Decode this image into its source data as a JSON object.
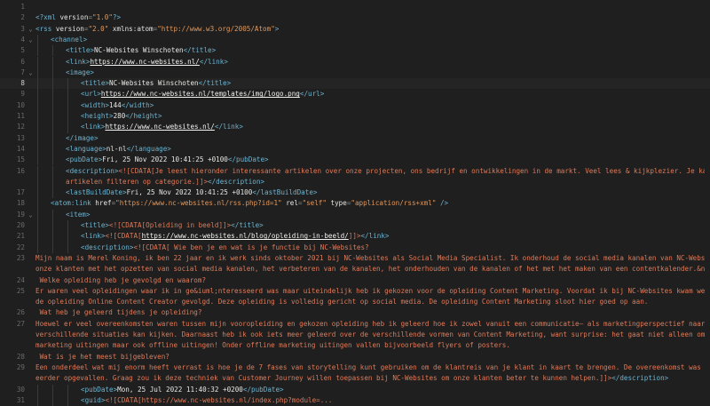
{
  "colors": {
    "background": "#1e1f1e",
    "tag": "#6eb4d2",
    "attribute": "#e5e5e3",
    "string": "#e3985f",
    "cdata": "#e07a5a",
    "text": "#e8e8e6",
    "line_number": "#6a6b69"
  },
  "current_line": 8,
  "lines": [
    {
      "n": "1",
      "fold": "",
      "indent": 0,
      "tokens": []
    },
    {
      "n": "2",
      "fold": "",
      "indent": 0,
      "tokens": [
        {
          "t": "tag",
          "v": "<?xml "
        },
        {
          "t": "attr",
          "v": "version"
        },
        {
          "t": "punct",
          "v": "="
        },
        {
          "t": "str",
          "v": "\"1.0\""
        },
        {
          "t": "tag",
          "v": "?>"
        }
      ]
    },
    {
      "n": "3",
      "fold": "v",
      "indent": 0,
      "tokens": [
        {
          "t": "tag",
          "v": "<rss "
        },
        {
          "t": "attr",
          "v": "version"
        },
        {
          "t": "punct",
          "v": "="
        },
        {
          "t": "str",
          "v": "\"2.0\""
        },
        {
          "t": "text",
          "v": " "
        },
        {
          "t": "attr",
          "v": "xmlns:atom"
        },
        {
          "t": "punct",
          "v": "="
        },
        {
          "t": "str",
          "v": "\"http://www.w3.org/2005/Atom\""
        },
        {
          "t": "tag",
          "v": ">"
        }
      ]
    },
    {
      "n": "4",
      "fold": "v",
      "indent": 1,
      "tokens": [
        {
          "t": "tag",
          "v": "<channel>"
        }
      ]
    },
    {
      "n": "5",
      "fold": "",
      "indent": 2,
      "tokens": [
        {
          "t": "tag",
          "v": "<title>"
        },
        {
          "t": "text",
          "v": "NC-Websites Winschoten"
        },
        {
          "t": "tag",
          "v": "</title>"
        }
      ]
    },
    {
      "n": "6",
      "fold": "",
      "indent": 2,
      "tokens": [
        {
          "t": "tag",
          "v": "<link>"
        },
        {
          "t": "url",
          "v": "https://www.nc-websites.nl/"
        },
        {
          "t": "tag",
          "v": "</link>"
        }
      ]
    },
    {
      "n": "7",
      "fold": "v",
      "indent": 2,
      "tokens": [
        {
          "t": "tag",
          "v": "<image>"
        }
      ]
    },
    {
      "n": "8",
      "fold": "",
      "indent": 3,
      "tokens": [
        {
          "t": "tag",
          "v": "<title>"
        },
        {
          "t": "text",
          "v": "NC-Websites Winschoten"
        },
        {
          "t": "tag",
          "v": "</title>"
        }
      ]
    },
    {
      "n": "9",
      "fold": "",
      "indent": 3,
      "tokens": [
        {
          "t": "tag",
          "v": "<url>"
        },
        {
          "t": "url",
          "v": "https://www.nc-websites.nl/templates/img/logo.png"
        },
        {
          "t": "tag",
          "v": "</url>"
        }
      ]
    },
    {
      "n": "10",
      "fold": "",
      "indent": 3,
      "tokens": [
        {
          "t": "tag",
          "v": "<width>"
        },
        {
          "t": "text",
          "v": "144"
        },
        {
          "t": "tag",
          "v": "</width>"
        }
      ]
    },
    {
      "n": "11",
      "fold": "",
      "indent": 3,
      "tokens": [
        {
          "t": "tag",
          "v": "<height>"
        },
        {
          "t": "text",
          "v": "280"
        },
        {
          "t": "tag",
          "v": "</height>"
        }
      ]
    },
    {
      "n": "12",
      "fold": "",
      "indent": 3,
      "tokens": [
        {
          "t": "tag",
          "v": "<link>"
        },
        {
          "t": "url",
          "v": "https://www.nc-websites.nl/"
        },
        {
          "t": "tag",
          "v": "</link>"
        }
      ]
    },
    {
      "n": "13",
      "fold": "",
      "indent": 2,
      "tokens": [
        {
          "t": "tag",
          "v": "</image>"
        }
      ]
    },
    {
      "n": "14",
      "fold": "",
      "indent": 2,
      "tokens": [
        {
          "t": "tag",
          "v": "<language>"
        },
        {
          "t": "text",
          "v": "nl-nl"
        },
        {
          "t": "tag",
          "v": "</language>"
        }
      ]
    },
    {
      "n": "15",
      "fold": "",
      "indent": 2,
      "tokens": [
        {
          "t": "tag",
          "v": "<pubDate>"
        },
        {
          "t": "text",
          "v": "Fri, 25 Nov 2022 10:41:25 +0100"
        },
        {
          "t": "tag",
          "v": "</pubDate>"
        }
      ]
    },
    {
      "n": "16",
      "fold": "",
      "indent": 2,
      "tokens": [
        {
          "t": "tag",
          "v": "<description>"
        },
        {
          "t": "cdata",
          "v": "<![CDATA[Je leest hieronder interessante artikelen over onze projecten, ons bedrijf en ontwikkelingen in de markt. Veel lees & kijkplezier. Je kan de"
        }
      ]
    },
    {
      "n": "",
      "fold": "",
      "indent": 2,
      "tokens": [
        {
          "t": "cdata",
          "v": "artikelen filteren op categorie.]]>"
        },
        {
          "t": "tag",
          "v": "</description>"
        }
      ]
    },
    {
      "n": "17",
      "fold": "",
      "indent": 2,
      "tokens": [
        {
          "t": "tag",
          "v": "<lastBuildDate>"
        },
        {
          "t": "text",
          "v": "Fri, 25 Nov 2022 10:41:25 +0100"
        },
        {
          "t": "tag",
          "v": "</lastBuildDate>"
        }
      ]
    },
    {
      "n": "18",
      "fold": "",
      "indent": 1,
      "tokens": [
        {
          "t": "tag",
          "v": "<atom:link "
        },
        {
          "t": "attr",
          "v": "href"
        },
        {
          "t": "punct",
          "v": "="
        },
        {
          "t": "str",
          "v": "\"https://www.nc-websites.nl/rss.php?id=1\""
        },
        {
          "t": "text",
          "v": " "
        },
        {
          "t": "attr",
          "v": "rel"
        },
        {
          "t": "punct",
          "v": "="
        },
        {
          "t": "str",
          "v": "\"self\""
        },
        {
          "t": "text",
          "v": " "
        },
        {
          "t": "attr",
          "v": "type"
        },
        {
          "t": "punct",
          "v": "="
        },
        {
          "t": "str",
          "v": "\"application/rss+xml\""
        },
        {
          "t": "tag",
          "v": " />"
        }
      ]
    },
    {
      "n": "19",
      "fold": "v",
      "indent": 2,
      "tokens": [
        {
          "t": "tag",
          "v": "<item>"
        }
      ]
    },
    {
      "n": "20",
      "fold": "",
      "indent": 3,
      "tokens": [
        {
          "t": "tag",
          "v": "<title>"
        },
        {
          "t": "cdata",
          "v": "<![CDATA[Opleiding in beeld]]>"
        },
        {
          "t": "tag",
          "v": "</title>"
        }
      ]
    },
    {
      "n": "21",
      "fold": "",
      "indent": 3,
      "tokens": [
        {
          "t": "tag",
          "v": "<link>"
        },
        {
          "t": "cdata",
          "v": "<![CDATA["
        },
        {
          "t": "url",
          "v": "https://www.nc-websites.nl/blog/opleiding-in-beeld/"
        },
        {
          "t": "cdata",
          "v": "]]>"
        },
        {
          "t": "tag",
          "v": "</link>"
        }
      ]
    },
    {
      "n": "22",
      "fold": "",
      "indent": 3,
      "tokens": [
        {
          "t": "tag",
          "v": "<description>"
        },
        {
          "t": "cdata",
          "v": "<![CDATA[ Wie ben je en wat is je functie bij NC-Websites?"
        }
      ]
    },
    {
      "n": "23",
      "fold": "",
      "indent": 0,
      "tokens": [
        {
          "t": "cdata",
          "v": "Mijn naam is Merel Koning, ik ben 22 jaar en ik werk sinds oktober 2021 bij NC-Websites als Social Media Specialist. Ik onderhoud de social media kanalen van NC-Websites en help"
        }
      ]
    },
    {
      "n": "",
      "fold": "",
      "indent": 0,
      "tokens": [
        {
          "t": "cdata",
          "v": "onze klanten met het opzetten van social media kanalen, het verbeteren van de kanalen, het onderhouden van de kanalen of het met het maken van een contentkalender.&nbsp;"
        }
      ]
    },
    {
      "n": "24",
      "fold": "",
      "indent": 0,
      "tokens": [
        {
          "t": "cdata",
          "v": " Welke opleiding heb je gevolgd en waarom?"
        }
      ]
    },
    {
      "n": "25",
      "fold": "",
      "indent": 0,
      "tokens": [
        {
          "t": "cdata",
          "v": "Er waren veel opleidingen waar ik in ge&iuml;nteresseerd was maar uiteindelijk heb ik gekozen voor de opleiding Content Marketing. Voordat ik bij NC-Websites kwam werken heb ik"
        }
      ]
    },
    {
      "n": "",
      "fold": "",
      "indent": 0,
      "tokens": [
        {
          "t": "cdata",
          "v": "de opleiding Online Content Creator gevolgd. Deze opleiding is volledig gericht op social media. De opleiding Content Marketing sloot hier goed op aan."
        }
      ]
    },
    {
      "n": "26",
      "fold": "",
      "indent": 0,
      "tokens": [
        {
          "t": "cdata",
          "v": " Wat heb je geleerd tijdens je opleiding?"
        }
      ]
    },
    {
      "n": "27",
      "fold": "",
      "indent": 0,
      "tokens": [
        {
          "t": "cdata",
          "v": "Hoewel er veel overeenkomsten waren tussen mijn vooropleiding en gekozen opleiding heb ik geleerd hoe ik zowel vanuit een communicatie— als marketingperspectief naar"
        }
      ]
    },
    {
      "n": "",
      "fold": "",
      "indent": 0,
      "tokens": [
        {
          "t": "cdata",
          "v": "verschillende situaties kan kijken. Daarnaast heb ik ook iets meer geleerd over de verschillende vormen van Content Marketing, want surprise: het gaat niet alleen om online"
        }
      ]
    },
    {
      "n": "",
      "fold": "",
      "indent": 0,
      "tokens": [
        {
          "t": "cdata",
          "v": "marketing uitingen maar ook offline uitingen! Onder offline marketing uitingen vallen bijvoorbeeld flyers of posters."
        }
      ]
    },
    {
      "n": "28",
      "fold": "",
      "indent": 0,
      "tokens": [
        {
          "t": "cdata",
          "v": " Wat is je het meest bijgebleven?"
        }
      ]
    },
    {
      "n": "29",
      "fold": "",
      "indent": 0,
      "tokens": [
        {
          "t": "cdata",
          "v": "Een onderdeel wat mij enorm heeft verrast is hoe je de 7 fases van storytelling kunt gebruiken om de klantreis van je klant in kaart te brengen. De overeenkomst was me nog niet"
        }
      ]
    },
    {
      "n": "",
      "fold": "",
      "indent": 0,
      "tokens": [
        {
          "t": "cdata",
          "v": "eerder opgevallen. Graag zou ik deze techniek van Customer Journey willen toepassen bij NC-Websites om onze klanten beter te kunnen helpen.]]>"
        },
        {
          "t": "tag",
          "v": "</description>"
        }
      ]
    },
    {
      "n": "30",
      "fold": "",
      "indent": 3,
      "tokens": [
        {
          "t": "tag",
          "v": "<pubDate>"
        },
        {
          "t": "text",
          "v": "Mon, 25 Jul 2022 11:40:32 +0200"
        },
        {
          "t": "tag",
          "v": "</pubDate>"
        }
      ]
    },
    {
      "n": "31",
      "fold": "",
      "indent": 3,
      "tokens": [
        {
          "t": "tag",
          "v": "<guid>"
        },
        {
          "t": "cdata",
          "v": "<![CDATA[https://www.nc-websites.nl/index.php?module=..."
        }
      ]
    }
  ]
}
